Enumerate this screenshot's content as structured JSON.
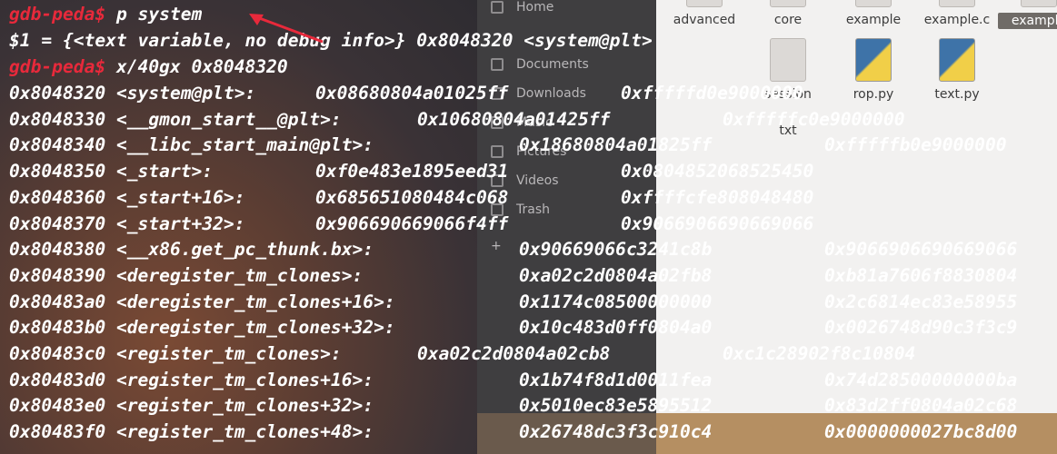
{
  "terminal": {
    "prompt": "gdb-peda$",
    "cmd1": " p system",
    "result1": "$1 = {<text variable, no debug info>} 0x8048320 <system@plt>",
    "cmd2": " x/40gx 0x8048320",
    "rows": [
      {
        "addr": "0x8048320 <system@plt>:",
        "v1": "0x08680804a01025ff",
        "v2": "0xfffffd0e9000000"
      },
      {
        "addr": "0x8048330 <__gmon_start__@plt>:",
        "v1": "0x10680804a01425ff",
        "v2": "0xfffffc0e9000000"
      },
      {
        "addr": "0x8048340 <__libc_start_main@plt>:",
        "v1": "0x18680804a01825ff",
        "v2": "0xfffffb0e9000000"
      },
      {
        "addr": "0x8048350 <_start>:",
        "v1": "0xf0e483e1895eed31",
        "v2": "0x0804852068525450"
      },
      {
        "addr": "0x8048360 <_start+16>:",
        "v1": "0x685651080484c068",
        "v2": "0xffffcfe808048480"
      },
      {
        "addr": "0x8048370 <_start+32>:",
        "v1": "0x906690669066f4ff",
        "v2": "0x9066906690669066"
      },
      {
        "addr": "0x8048380 <__x86.get_pc_thunk.bx>:",
        "v1": "0x90669066c3241c8b",
        "v2": "0x9066906690669066"
      },
      {
        "addr": "0x8048390 <deregister_tm_clones>:",
        "v1": "0xa02c2d0804a02fb8",
        "v2": "0xb81a7606f8830804"
      },
      {
        "addr": "0x80483a0 <deregister_tm_clones+16>:",
        "v1": "0x1174c08500000000",
        "v2": "0x2c6814ec83e58955"
      },
      {
        "addr": "0x80483b0 <deregister_tm_clones+32>:",
        "v1": "0x10c483d0ff0804a0",
        "v2": "0x0026748d90c3f3c9"
      },
      {
        "addr": "0x80483c0 <register_tm_clones>:",
        "v1": "0xa02c2d0804a02cb8",
        "v2": "0xc1c28902f8c10804"
      },
      {
        "addr": "0x80483d0 <register_tm_clones+16>:",
        "v1": "0x1b74f8d1d0011fea",
        "v2": "0x74d28500000000ba"
      },
      {
        "addr": "0x80483e0 <register_tm_clones+32>:",
        "v1": "0x5010ec83e5895512",
        "v2": "0x83d2ff0804a02c68"
      },
      {
        "addr": "0x80483f0 <register_tm_clones+48>:",
        "v1": "0x26748dc3f3c910c4",
        "v2": "0x0000000027bc8d00"
      }
    ]
  },
  "sidebar": {
    "items": [
      {
        "label": "Home",
        "icon": "home-icon"
      },
      {
        "label": "Documents",
        "icon": "document-icon"
      },
      {
        "label": "Downloads",
        "icon": "download-icon"
      },
      {
        "label": "Music",
        "icon": "music-icon"
      },
      {
        "label": "Pictures",
        "icon": "camera-icon"
      },
      {
        "label": "Videos",
        "icon": "video-icon"
      },
      {
        "label": "Trash",
        "icon": "trash-icon"
      },
      {
        "label": "+",
        "icon": "plus-icon"
      }
    ]
  },
  "files": {
    "top_row": [
      "advanced",
      "core",
      "example",
      "example.c",
      "example"
    ],
    "second_row": [
      "rop.py",
      "text.py"
    ],
    "partial": [
      "session",
      "txt"
    ]
  },
  "colors": {
    "prompt": "#e8293b",
    "text": "#ffffff",
    "arrow": "#e8293b"
  }
}
